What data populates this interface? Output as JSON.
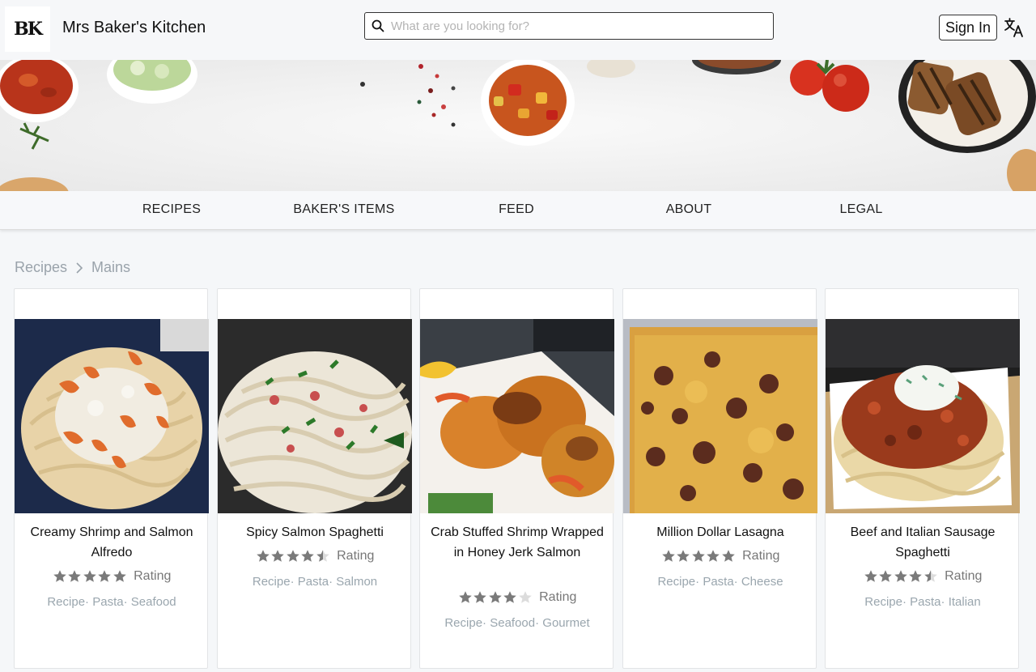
{
  "header": {
    "logo_text": "BK",
    "site_title": "Mrs Baker's Kitchen",
    "search_placeholder": "What are you looking for?",
    "sign_in_label": "Sign In"
  },
  "nav": {
    "items": [
      "RECIPES",
      "BAKER'S ITEMS",
      "FEED",
      "ABOUT",
      "LEGAL"
    ]
  },
  "breadcrumb": {
    "items": [
      "Recipes",
      "Mains"
    ]
  },
  "recipes": [
    {
      "title": "Creamy Shrimp and Salmon Alfredo",
      "stars": 5,
      "rating_label": "Rating",
      "tags": [
        "Recipe",
        "Pasta",
        "Seafood"
      ]
    },
    {
      "title": "Spicy Salmon Spaghetti",
      "stars": 4.5,
      "rating_label": "Rating",
      "tags": [
        "Recipe",
        "Pasta",
        "Salmon"
      ]
    },
    {
      "title": "Crab Stuffed Shrimp Wrapped in Honey Jerk Salmon",
      "stars": 4,
      "rating_label": "Rating",
      "tags": [
        "Recipe",
        "Seafood",
        "Gourmet"
      ]
    },
    {
      "title": "Million Dollar Lasagna",
      "stars": 5,
      "rating_label": "Rating",
      "tags": [
        "Recipe",
        "Pasta",
        "Cheese"
      ]
    },
    {
      "title": "Beef and Italian Sausage Spaghetti",
      "stars": 4.5,
      "rating_label": "Rating",
      "tags": [
        "Recipe",
        "Pasta",
        "Italian"
      ]
    }
  ],
  "colors": {
    "star_filled": "#7a7a7a",
    "star_empty": "#dcdcdc",
    "tag_text": "#9aa6ae"
  }
}
